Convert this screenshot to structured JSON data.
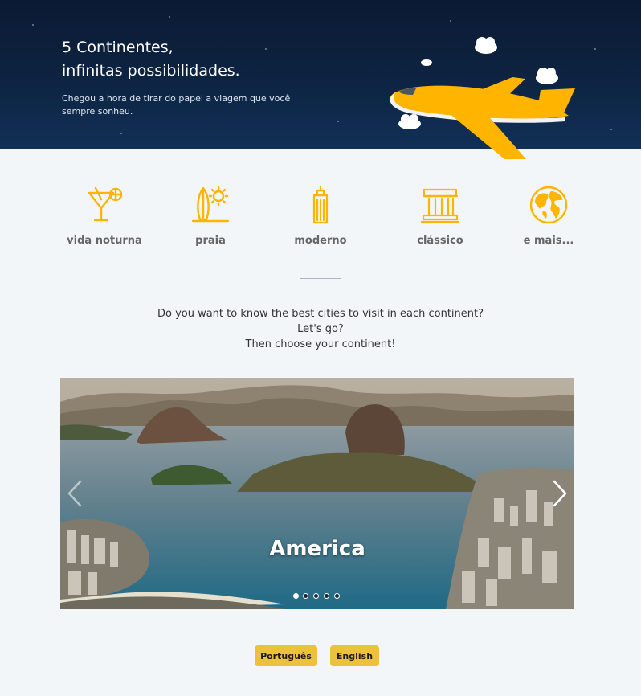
{
  "hero": {
    "title_line1": "5 Continentes,",
    "title_line2": "infinitas possibilidades.",
    "subtitle": "Chegou a hora de tirar do papel a viagem que você sempre sonheu."
  },
  "categories": [
    {
      "label": "vida noturna",
      "icon": "cocktail-icon"
    },
    {
      "label": "praia",
      "icon": "surfboard-sun-icon"
    },
    {
      "label": "moderno",
      "icon": "skyscraper-icon"
    },
    {
      "label": "clássico",
      "icon": "classical-building-icon"
    },
    {
      "label": "e mais...",
      "icon": "globe-icon"
    }
  ],
  "intro": {
    "line1": "Do you want to know the best cities to visit in each continent?",
    "line2": "Let's go?",
    "line3": "Then choose your continent!"
  },
  "carousel": {
    "current_caption": "America",
    "slide_count": 5,
    "active_index": 0
  },
  "languages": {
    "portuguese": "Português",
    "english": "English"
  },
  "colors": {
    "accent": "#ffb400",
    "button": "#ecc23a",
    "hero_bg": "#0d2442"
  }
}
